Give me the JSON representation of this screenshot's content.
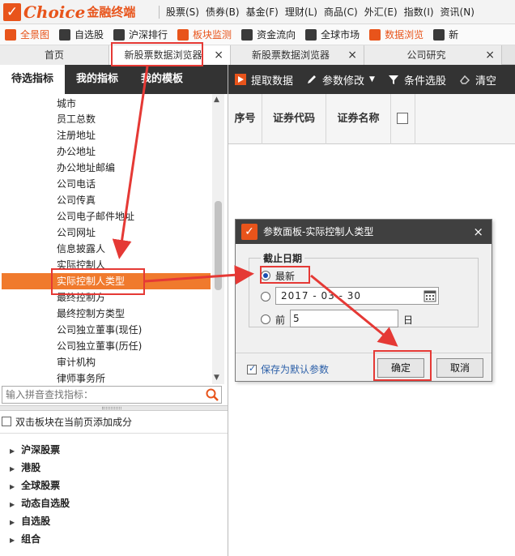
{
  "app": {
    "logo_main": "Choice",
    "logo_sub": "金融终端",
    "menu": [
      "股票(S)",
      "债券(B)",
      "基金(F)",
      "理财(L)",
      "商品(C)",
      "外汇(E)",
      "指数(I)",
      "资讯(N)"
    ]
  },
  "toolbar": {
    "items": [
      "全景图",
      "自选股",
      "沪深排行",
      "板块监测",
      "资金流向",
      "全球市场",
      "数据浏览",
      "新"
    ]
  },
  "tabs": {
    "home": "首页",
    "active": "新股票数据浏览器",
    "second": "新股票数据浏览器",
    "third": "公司研究",
    "close_glyph": "×"
  },
  "left_panel": {
    "tabs": [
      "待选指标",
      "我的指标",
      "我的模板"
    ],
    "tree_items": [
      "城市",
      "员工总数",
      "注册地址",
      "办公地址",
      "办公地址邮编",
      "公司电话",
      "公司传真",
      "公司电子邮件地址",
      "公司网址",
      "信息披露人",
      "实际控制人",
      "实际控制人类型",
      "最终控制方",
      "最终控制方类型",
      "公司独立董事(现任)",
      "公司独立董事(历任)",
      "审计机构",
      "律师事务所"
    ],
    "selected_index": 11,
    "search_placeholder": "输入拼音查找指标：",
    "add_to_block_label": "双击板块在当前页添加成分",
    "groups": [
      "沪深股票",
      "港股",
      "全球股票",
      "动态自选股",
      "自选股",
      "组合"
    ]
  },
  "right_panel": {
    "buttons": [
      "提取数据",
      "参数修改",
      "条件选股",
      "清空"
    ],
    "columns": [
      "序号",
      "证券代码",
      "证券名称"
    ]
  },
  "dialog": {
    "title": "参数面板-实际控制人类型",
    "close": "×",
    "group_label": "截止日期",
    "option_latest": "最新",
    "date_value": "2017 - 03 - 30",
    "option_prev": "前",
    "prev_value": "5",
    "prev_unit": "日",
    "save_default": "保存为默认参数",
    "ok": "确定",
    "cancel": "取消"
  },
  "colors": {
    "brand": "#e8541b",
    "selected_row": "#f07a2d",
    "dark_header": "#333333",
    "annotation": "#e53935"
  }
}
